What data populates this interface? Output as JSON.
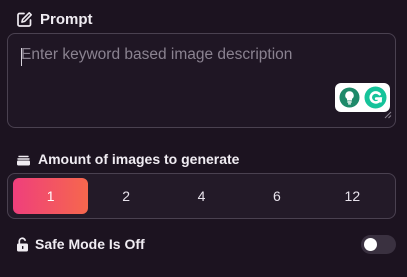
{
  "prompt": {
    "label": "Prompt",
    "label_icon": "edit-square-icon",
    "value": "",
    "placeholder": "Enter keyword based image description",
    "extension_icons": [
      "bulb-assistant-icon",
      "grammarly-icon"
    ],
    "extension_colors": {
      "bulb": "#1e8a6a",
      "grammarly": "#15c39a"
    }
  },
  "amount": {
    "label": "Amount of images to generate",
    "label_icon": "image-stack-icon",
    "options": [
      "1",
      "2",
      "4",
      "6",
      "12"
    ],
    "selected": "1",
    "accent_gradient": [
      "#ef3f7c",
      "#f6674d"
    ]
  },
  "safe_mode": {
    "label": "Safe Mode Is Off",
    "label_icon": "unlock-icon",
    "enabled": false
  },
  "theme": {
    "background": "#1c1320",
    "border": "#4a4150",
    "text": "#f0ecf2"
  }
}
